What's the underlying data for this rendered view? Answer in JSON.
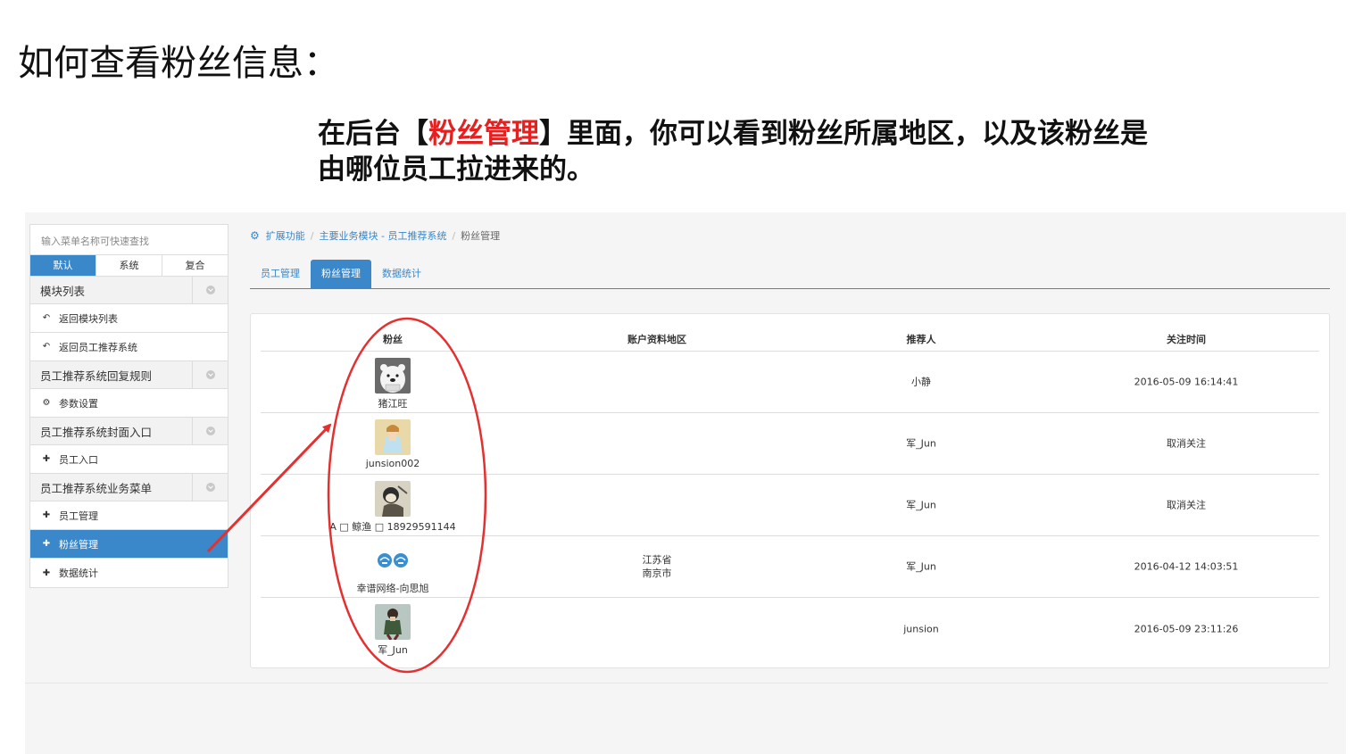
{
  "slide": {
    "title": "如何查看粉丝信息：",
    "desc_before": "在后台【",
    "desc_highlight": "粉丝管理",
    "desc_after": "】里面，你可以看到粉丝所属地区，以及该粉丝是由哪位员工拉进来的。",
    "highlight_color": "#e52020"
  },
  "sidebar": {
    "search_placeholder": "输入菜单名称可快速查找",
    "tabs": [
      {
        "label": "默认",
        "active": true
      },
      {
        "label": "系统",
        "active": false
      },
      {
        "label": "复合",
        "active": false
      }
    ],
    "groups": [
      {
        "label": "模块列表",
        "items": [
          {
            "label": "返回模块列表",
            "icon": "back-icon"
          },
          {
            "label": "返回员工推荐系统",
            "icon": "back-icon"
          }
        ]
      },
      {
        "label": "员工推荐系统回复规则",
        "items": [
          {
            "label": "参数设置",
            "icon": "gear-icon"
          }
        ]
      },
      {
        "label": "员工推荐系统封面入口",
        "items": [
          {
            "label": "员工入口",
            "icon": "puzzle-icon"
          }
        ]
      },
      {
        "label": "员工推荐系统业务菜单",
        "items": [
          {
            "label": "员工管理",
            "icon": "puzzle-icon"
          },
          {
            "label": "粉丝管理",
            "icon": "puzzle-icon",
            "active": true
          },
          {
            "label": "数据统计",
            "icon": "puzzle-icon"
          }
        ]
      }
    ]
  },
  "breadcrumb": {
    "items": [
      "扩展功能",
      "主要业务模块 - 员工推荐系统",
      "粉丝管理"
    ]
  },
  "tabs": [
    {
      "label": "员工管理",
      "active": false
    },
    {
      "label": "粉丝管理",
      "active": true
    },
    {
      "label": "数据统计",
      "active": false
    }
  ],
  "table": {
    "headers": [
      "粉丝",
      "账户资料地区",
      "推荐人",
      "关注时间"
    ],
    "rows": [
      {
        "fan": "猪江旺",
        "avatar": "polar-bear-avatar",
        "region": "",
        "referrer": "小静",
        "time": "2016-05-09 16:14:41"
      },
      {
        "fan": "junsion002",
        "avatar": "anime-girl-avatar",
        "region": "",
        "referrer": "军_Jun",
        "time": "取消关注"
      },
      {
        "fan": "A □ 鲸渔 □ 18929591144",
        "avatar": "comic-character-avatar",
        "region": "",
        "referrer": "军_Jun",
        "time": "取消关注"
      },
      {
        "fan": "幸谱网络-向思旭",
        "avatar": "blue-faces-avatar",
        "region": "江苏省\n南京市",
        "referrer": "军_Jun",
        "time": "2016-04-12 14:03:51"
      },
      {
        "fan": "军_Jun",
        "avatar": "soldier-avatar",
        "region": "",
        "referrer": "junsion",
        "time": "2016-05-09 23:11:26"
      }
    ]
  },
  "annotation": {
    "color": "#e53030"
  }
}
